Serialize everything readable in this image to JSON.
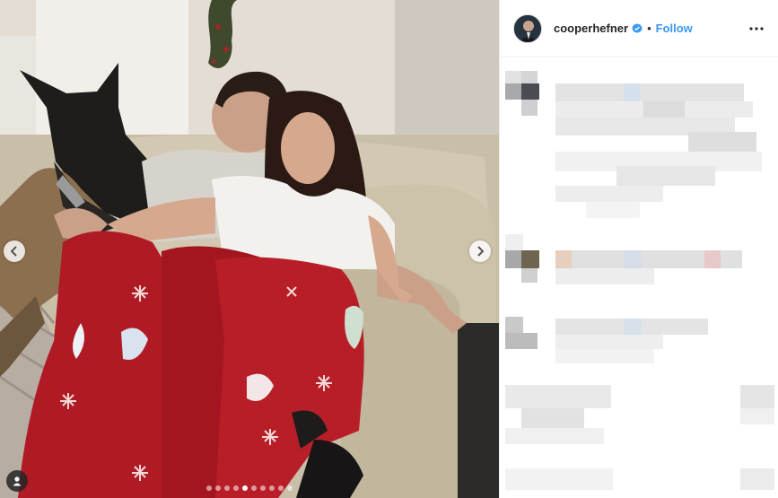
{
  "post": {
    "author": {
      "username": "cooperhefner",
      "verified": true,
      "separator": "•",
      "follow_label": "Follow"
    },
    "carousel": {
      "slide_count": 10,
      "active_index": 4
    },
    "icons": {
      "prev": "chevron-left-icon",
      "next": "chevron-right-icon",
      "tags": "user-tag-icon",
      "more": "more-options-icon",
      "verified": "verified-badge-icon"
    },
    "colors": {
      "follow": "#3897f0",
      "verified": "#3897f0",
      "text": "#262626",
      "pajamas": "#b01a24"
    },
    "comments_state": "pixelated"
  }
}
